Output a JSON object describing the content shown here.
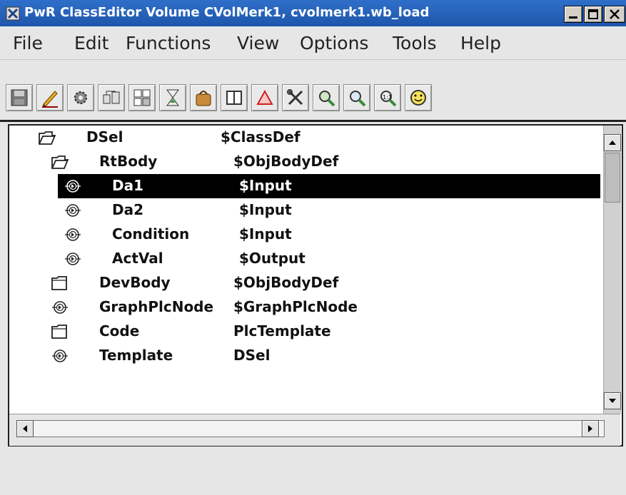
{
  "window": {
    "title": "PwR ClassEditor Volume CVolMerk1, cvolmerk1.wb_load",
    "title_color": "#1e56aa"
  },
  "menu": [
    "File",
    "Edit",
    "Functions",
    "View",
    "Options",
    "Tools",
    "Help"
  ],
  "toolbar": {
    "icons": [
      "save-icon",
      "edit-pencil-icon",
      "gear-icon",
      "hierarchy-icon",
      "diagram-icon",
      "hourglass-icon",
      "package-icon",
      "book-icon",
      "warning-triangle-icon",
      "tools-icon",
      "zoom-in-icon",
      "zoom-out-icon",
      "zoom-reset-icon",
      "smiley-icon"
    ]
  },
  "tree": {
    "rows": [
      {
        "name": "DSel",
        "class": "$ClassDef",
        "icon": "folder-open-icon",
        "selected": false
      },
      {
        "name": "RtBody",
        "class": "$ObjBodyDef",
        "icon": "folder-open-icon",
        "selected": false
      },
      {
        "name": "Da1",
        "class": "$Input",
        "icon": "attribute-icon",
        "selected": true
      },
      {
        "name": "Da2",
        "class": "$Input",
        "icon": "attribute-icon",
        "selected": false
      },
      {
        "name": "Condition",
        "class": "$Input",
        "icon": "attribute-icon",
        "selected": false
      },
      {
        "name": "ActVal",
        "class": "$Output",
        "icon": "attribute-icon",
        "selected": false
      },
      {
        "name": "DevBody",
        "class": "$ObjBodyDef",
        "icon": "folder-closed-icon",
        "selected": false
      },
      {
        "name": "GraphPlcNode",
        "class": "$GraphPlcNode",
        "icon": "attribute-icon",
        "selected": false
      },
      {
        "name": "Code",
        "class": "PlcTemplate",
        "icon": "folder-closed-icon",
        "selected": false
      },
      {
        "name": "Template",
        "class": "DSel",
        "icon": "attribute-icon",
        "selected": false
      }
    ]
  }
}
